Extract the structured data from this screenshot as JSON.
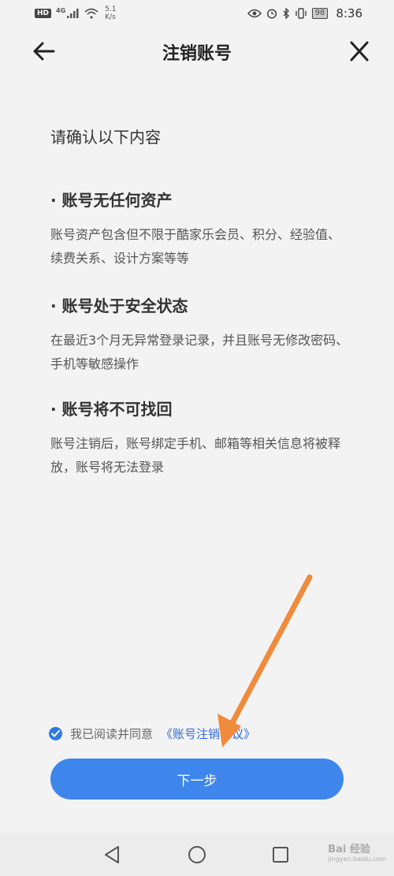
{
  "status_bar": {
    "hd": "HD",
    "network": "4G",
    "speed_value": "5.1",
    "speed_unit": "K/s",
    "battery": "98",
    "time": "8:36"
  },
  "header": {
    "title": "注销账号"
  },
  "content": {
    "intro": "请确认以下内容",
    "sections": [
      {
        "title": "· 账号无任何资产",
        "desc": "账号资产包含但不限于酷家乐会员、积分、经验值、续费关系、设计方案等等"
      },
      {
        "title": "· 账号处于安全状态",
        "desc": "在最近3个月无异常登录记录，并且账号无修改密码、手机等敏感操作"
      },
      {
        "title": "· 账号将不可找回",
        "desc": "账号注销后，账号绑定手机、邮箱等相关信息将被释放，账号将无法登录"
      }
    ]
  },
  "agreement": {
    "checked": true,
    "text": "我已阅读并同意",
    "link": "《账号注销协议》"
  },
  "next_button": "下一步",
  "colors": {
    "accent": "#3f86ec",
    "link": "#2f6ad8",
    "annotation_arrow": "#f08a3c"
  },
  "watermark": {
    "main": "Bai 经验",
    "sub": "jingyan.baidu.com"
  }
}
